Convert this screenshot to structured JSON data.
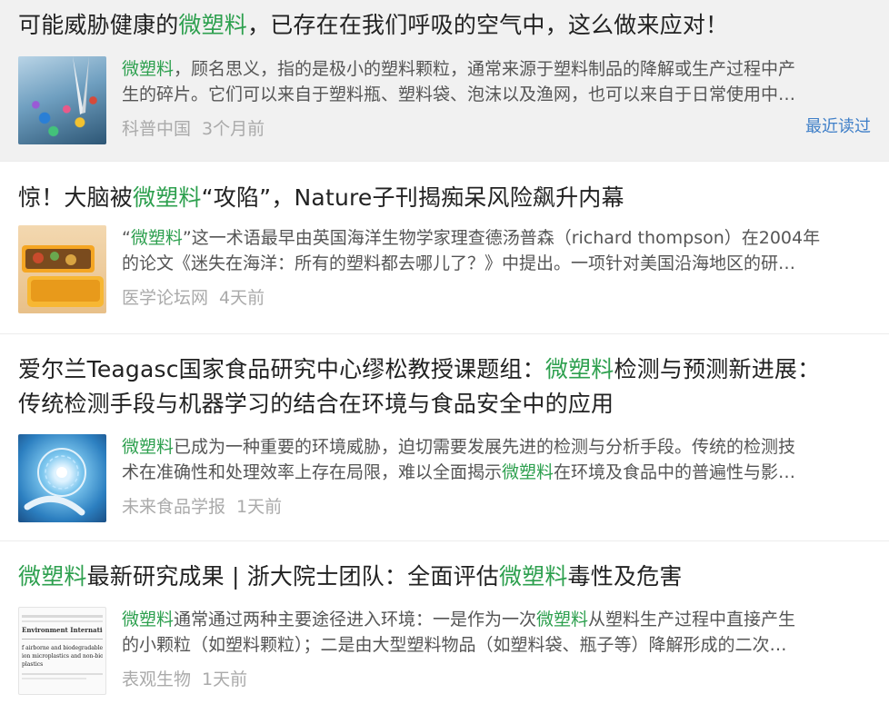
{
  "articles": [
    {
      "title": [
        "可能威胁健康的",
        "微塑料",
        "，已存在在我们呼吸的空气中，这么做来应对！"
      ],
      "summary_line1": [
        "微塑料",
        "，顾名思义，指的是极小的塑料颗粒，通常来源于塑料制品的降解或生产过程中产"
      ],
      "summary_line2": "生的碎片。它们可以来自于塑料瓶、塑料袋、泡沫以及渔网，也可以来自于日常使用中…",
      "source": "科普中国",
      "time": "3个月前",
      "badge": "最近读过",
      "thumb_icon": "microplastic-tweezers-image"
    },
    {
      "title": [
        "惊！大脑被",
        "微塑料",
        "“攻陷”，Nature子刊揭痴呆风险飙升内幕"
      ],
      "summary_line1": [
        "“",
        "微塑料",
        "”这一术语最早由英国海洋生物学家理查德汤普森（richard thompson）在2004年"
      ],
      "summary_line2": "的论文《迷失在海洋：所有的塑料都去哪儿了？》中提出。一项针对美国沿海地区的研…",
      "source": "医学论坛网",
      "time": "4天前",
      "thumb_icon": "plastic-food-container-image"
    },
    {
      "title_line1": [
        "爱尔兰Teagasc国家食品研究中心缪松教授课题组：",
        "微塑料",
        "检测与预测新进展："
      ],
      "title_line2": "传统检测手段与机器学习的结合在环境与食品安全中的应用",
      "summary_line1": [
        "微塑料",
        "已成为一种重要的环境威胁，迫切需要发展先进的检测与分析手段。传统的检测技"
      ],
      "summary_line2": [
        "术在准确性和处理效率上存在局限，难以全面揭示",
        "微塑料",
        "在环境及食品中的普遍性与影…"
      ],
      "source": "未来食品学报",
      "time": "1天前",
      "thumb_icon": "tech-robot-hand-image"
    },
    {
      "title": [
        "微塑料",
        "最新研究成果 | 浙大院士团队：全面评估",
        "微塑料",
        "毒性及危害"
      ],
      "summary_line1": [
        "微塑料",
        "通常通过两种主要途径进入环境：一是作为一次",
        "微塑料",
        "从塑料生产过程中直接产生"
      ],
      "summary_line2": "的小颗粒（如塑料颗粒）；二是由大型塑料物品（如塑料袋、瓶子等）降解形成的二次…",
      "source": "表观生物",
      "time": "1天前",
      "thumb_icon": "journal-paper-image",
      "thumb_text": {
        "journal": "Environment International",
        "line1": "f airborne and biodegradable",
        "line2": "ion microplastics and non-biodegradable",
        "line3": "plastics"
      }
    }
  ],
  "colors": {
    "highlight": "#2ea04f",
    "badge": "#3f7fc8",
    "meta": "#aaaaaa",
    "visited_bg": "#f1f1f1"
  }
}
